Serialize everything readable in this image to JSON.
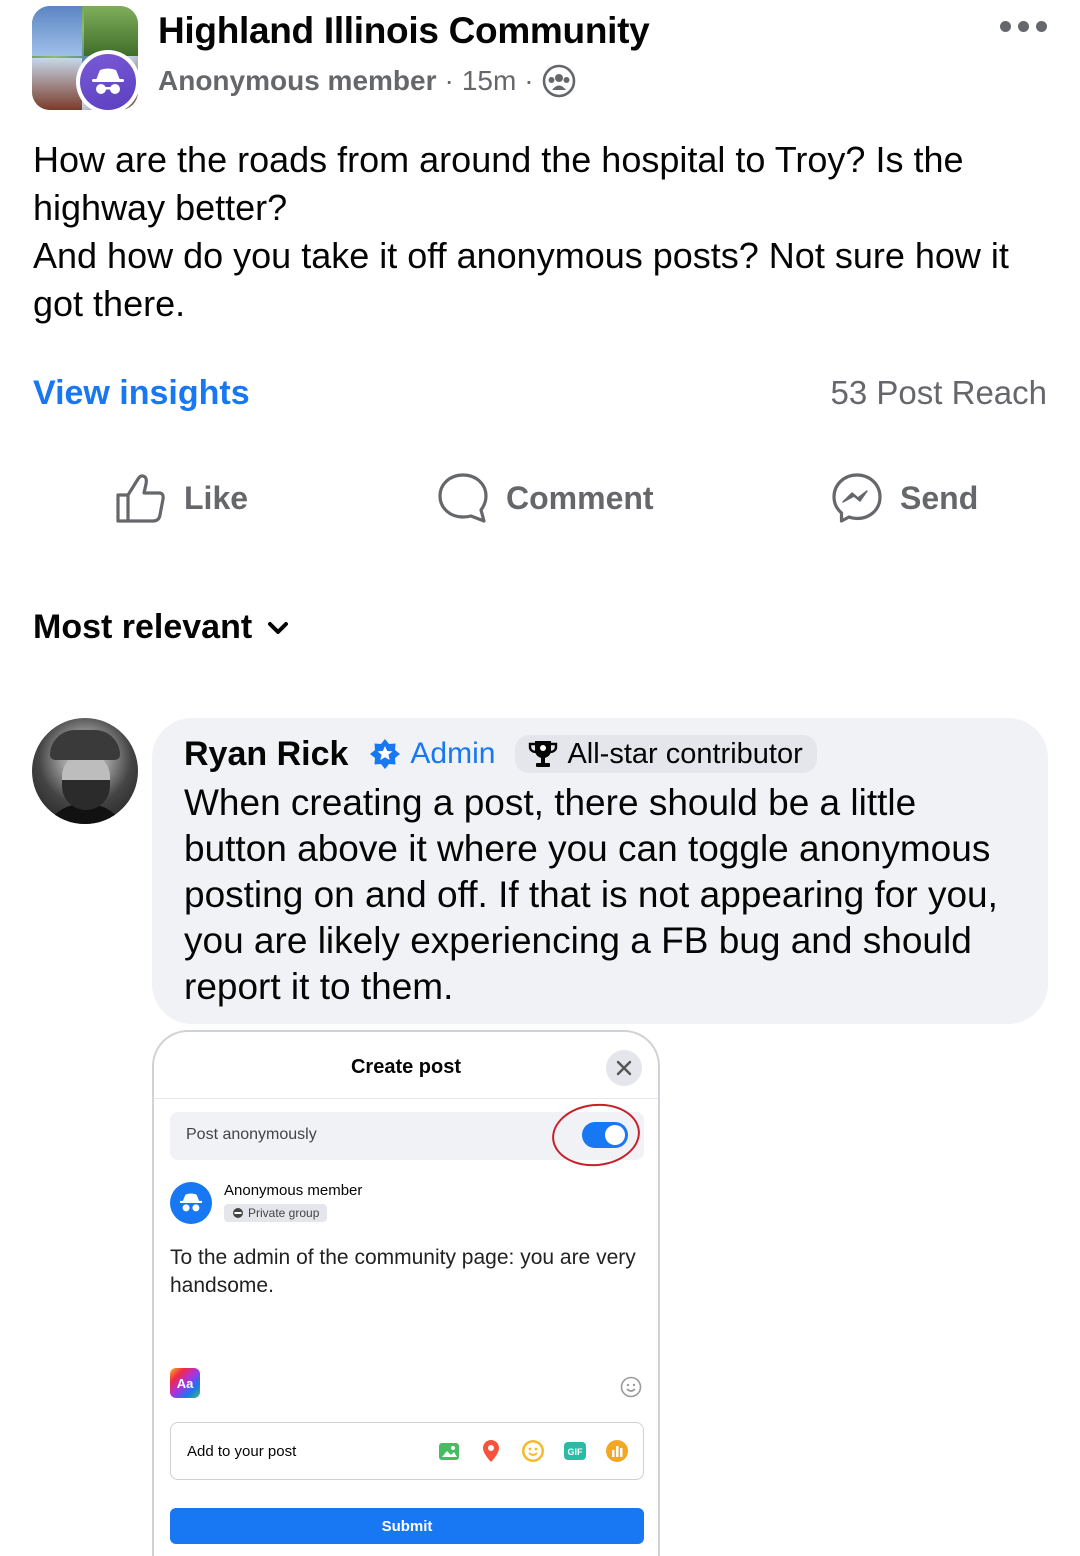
{
  "post": {
    "group_name": "Highland Illinois Community",
    "author": "Anonymous member",
    "time": "15m",
    "separator": "·",
    "more_icon": "more-horizontal-icon",
    "audience_icon": "group-icon",
    "text_lines": [
      "How are the roads from around the hospital to Troy? Is the highway better?",
      "And how do you take it off anonymous posts? Not sure how it got there."
    ],
    "view_insights": "View insights",
    "reach": "53 Post Reach"
  },
  "actions": {
    "like": "Like",
    "comment": "Comment",
    "send": "Send"
  },
  "sort": {
    "label": "Most relevant"
  },
  "comment": {
    "name": "Ryan Rick",
    "admin_label": "Admin",
    "contributor_label": "All-star contributor",
    "text": "When creating a post, there should be a little button above it where you can toggle anonymous posting on and off.  If that is not appearing for you, you are likely experiencing a FB bug and should report it to them."
  },
  "attachment": {
    "title": "Create post",
    "post_anonymously": "Post anonymously",
    "toggle_on": true,
    "user_name": "Anonymous member",
    "privacy": "Private group",
    "body": "To the admin of the community page: you are very handsome.",
    "aa_label": "Aa",
    "add_to_post": "Add to your post",
    "gif_label": "GIF",
    "submit": "Submit"
  },
  "colors": {
    "accent": "#1877f2",
    "secondary_text": "#65676b",
    "bubble_bg": "#f0f2f5",
    "annotation_red": "#c8202a"
  }
}
